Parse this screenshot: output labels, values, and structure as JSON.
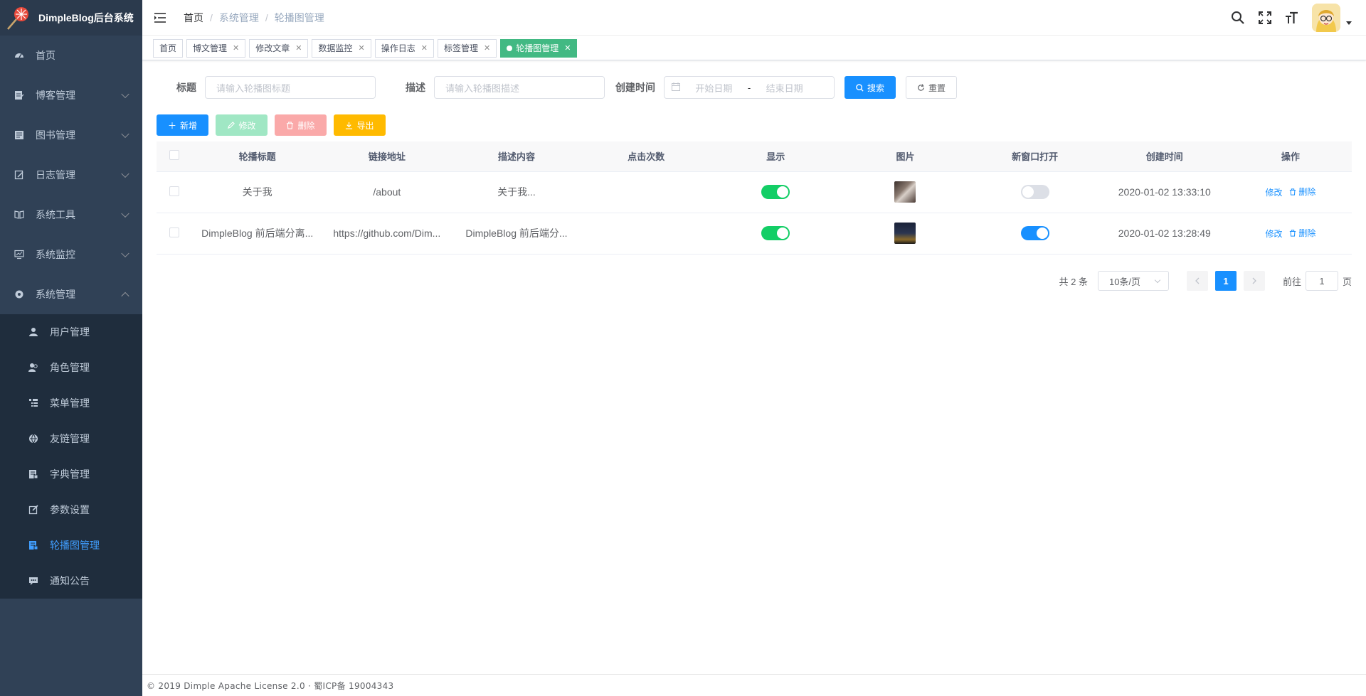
{
  "app": {
    "title": "DimpleBlog后台系统"
  },
  "sidebar": {
    "items": [
      {
        "label": "首页",
        "icon": "dashboard-icon",
        "expandable": false
      },
      {
        "label": "博客管理",
        "icon": "article-icon",
        "expandable": true
      },
      {
        "label": "图书管理",
        "icon": "book-icon",
        "expandable": true
      },
      {
        "label": "日志管理",
        "icon": "log-icon",
        "expandable": true
      },
      {
        "label": "系统工具",
        "icon": "tool-icon",
        "expandable": true
      },
      {
        "label": "系统监控",
        "icon": "monitor-icon",
        "expandable": true
      },
      {
        "label": "系统管理",
        "icon": "gear-icon",
        "expandable": true,
        "expanded": true
      }
    ],
    "sub_items": [
      {
        "label": "用户管理",
        "icon": "user-icon"
      },
      {
        "label": "角色管理",
        "icon": "peoples-icon"
      },
      {
        "label": "菜单管理",
        "icon": "tree-table-icon"
      },
      {
        "label": "友链管理",
        "icon": "link-icon"
      },
      {
        "label": "字典管理",
        "icon": "dict-icon"
      },
      {
        "label": "参数设置",
        "icon": "edit-icon"
      },
      {
        "label": "轮播图管理",
        "icon": "carousel-icon",
        "active": true
      },
      {
        "label": "通知公告",
        "icon": "message-icon"
      }
    ]
  },
  "navbar": {
    "breadcrumb": [
      "首页",
      "系统管理",
      "轮播图管理"
    ],
    "separator": "/"
  },
  "tags": [
    {
      "label": "首页",
      "closable": false
    },
    {
      "label": "博文管理",
      "closable": true
    },
    {
      "label": "修改文章",
      "closable": true
    },
    {
      "label": "数据监控",
      "closable": true
    },
    {
      "label": "操作日志",
      "closable": true
    },
    {
      "label": "标签管理",
      "closable": true
    },
    {
      "label": "轮播图管理",
      "closable": true,
      "active": true
    }
  ],
  "search": {
    "title_label": "标题",
    "title_placeholder": "请输入轮播图标题",
    "desc_label": "描述",
    "desc_placeholder": "请输入轮播图描述",
    "time_label": "创建时间",
    "start_placeholder": "开始日期",
    "range_sep": "-",
    "end_placeholder": "结束日期",
    "search_btn": "搜索",
    "reset_btn": "重置"
  },
  "toolbar": {
    "add": "新增",
    "edit": "修改",
    "delete": "删除",
    "export": "导出"
  },
  "table": {
    "headers": [
      "轮播标题",
      "链接地址",
      "描述内容",
      "点击次数",
      "显示",
      "图片",
      "新窗口打开",
      "创建时间",
      "操作"
    ],
    "rows": [
      {
        "title": "关于我",
        "url": "/about",
        "description": "关于我...",
        "clicks": "",
        "display": true,
        "new_window": false,
        "created": "2020-01-02 13:33:10",
        "image_color": "#6b5a55"
      },
      {
        "title": "DimpleBlog 前后端分离...",
        "url": "https://github.com/Dim...",
        "description": "DimpleBlog 前后端分...",
        "clicks": "",
        "display": true,
        "new_window": true,
        "created": "2020-01-02 13:28:49",
        "image_color": "#2b3550"
      }
    ],
    "op_edit": "修改",
    "op_delete": "删除"
  },
  "pagination": {
    "total_text": "共 2 条",
    "page_size": "10条/页",
    "current_page": "1",
    "goto_label": "前往",
    "goto_value": "1",
    "page_unit": "页"
  },
  "footer": {
    "text": "© 2019 Dimple Apache License 2.0 · 蜀ICP备 19004343"
  },
  "colors": {
    "sidebar_bg": "#304156",
    "primary": "#1890ff",
    "active_tag": "#42b983"
  }
}
